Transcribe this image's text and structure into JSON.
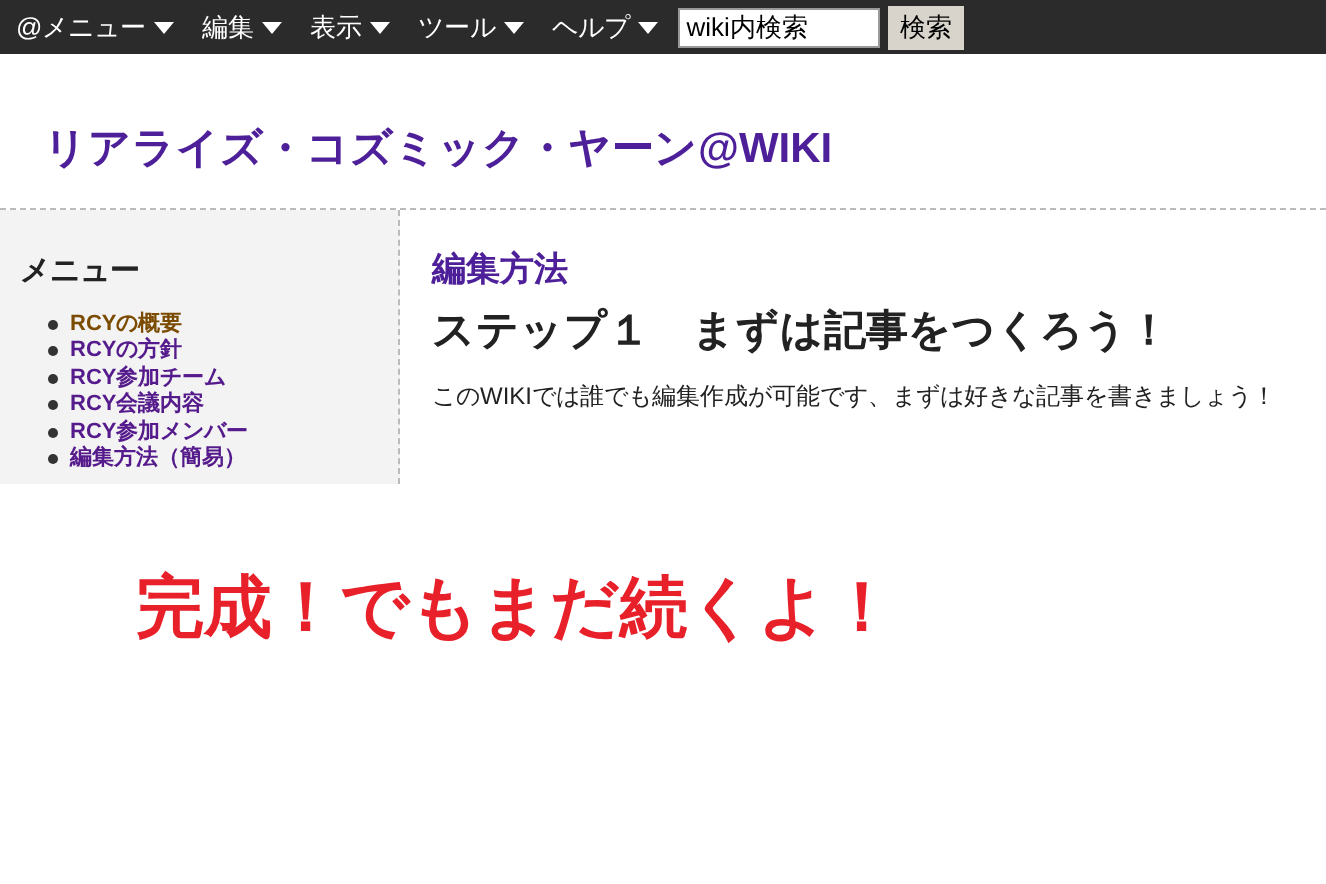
{
  "menubar": {
    "items": [
      {
        "label": "@メニュー"
      },
      {
        "label": "編集"
      },
      {
        "label": "表示"
      },
      {
        "label": "ツール"
      },
      {
        "label": "ヘルプ"
      }
    ],
    "search": {
      "value": "wiki内検索"
    },
    "search_button": "検索"
  },
  "site_title": "リアライズ・コズミック・ヤーン@WIKI",
  "sidebar": {
    "heading": "メニュー",
    "items": [
      {
        "label": "RCYの概要",
        "color": "#7a4b00"
      },
      {
        "label": "RCYの方針",
        "color": "#551a8b"
      },
      {
        "label": "RCY参加チーム",
        "color": "#551a8b"
      },
      {
        "label": "RCY会議内容",
        "color": "#551a8b"
      },
      {
        "label": "RCY参加メンバー",
        "color": "#551a8b"
      },
      {
        "label": "編集方法（簡易）",
        "color": "#551a8b"
      }
    ]
  },
  "content": {
    "page_title": "編集方法",
    "heading": "ステップ１　まずは記事をつくろう！",
    "body": "このWIKIでは誰でも編集作成が可能です、まずは好きな記事を書きましょう！"
  },
  "overlay_caption": "完成！でもまだ続くよ！"
}
